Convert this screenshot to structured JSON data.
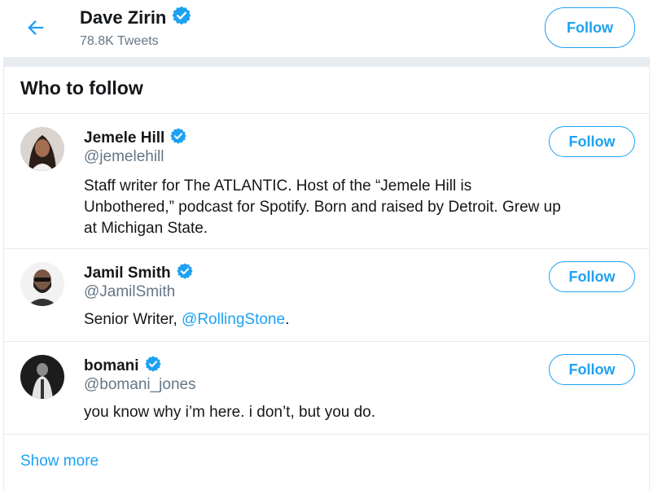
{
  "header": {
    "name": "Dave Zirin",
    "tweets": "78.8K Tweets",
    "follow_label": "Follow"
  },
  "who_to_follow": {
    "title": "Who to follow",
    "users": [
      {
        "name": "Jemele Hill",
        "handle": "@jemelehill",
        "bio_lines": [
          "Staff writer for The ATLANTIC. Host of the “Jemele Hill is",
          "Unbothered,” podcast for Spotify. Born and raised by Detroit. Grew up",
          "at Michigan State."
        ],
        "follow_label": "Follow"
      },
      {
        "name": "Jamil Smith",
        "handle": "@JamilSmith",
        "bio_prefix": "Senior Writer, ",
        "bio_mention": "@RollingStone",
        "bio_suffix": ".",
        "follow_label": "Follow"
      },
      {
        "name": "bomani",
        "handle": "@bomani_jones",
        "bio": "you know why i’m here. i don’t, but you do.",
        "follow_label": "Follow"
      }
    ],
    "show_more": "Show more"
  },
  "colors": {
    "accent": "#1da1f2",
    "verified": "#1da1f2",
    "secondary_text": "#657786",
    "divider": "#e6ecf0"
  },
  "icons": {
    "back": "arrow-left-icon",
    "verified": "verified-badge-icon"
  }
}
